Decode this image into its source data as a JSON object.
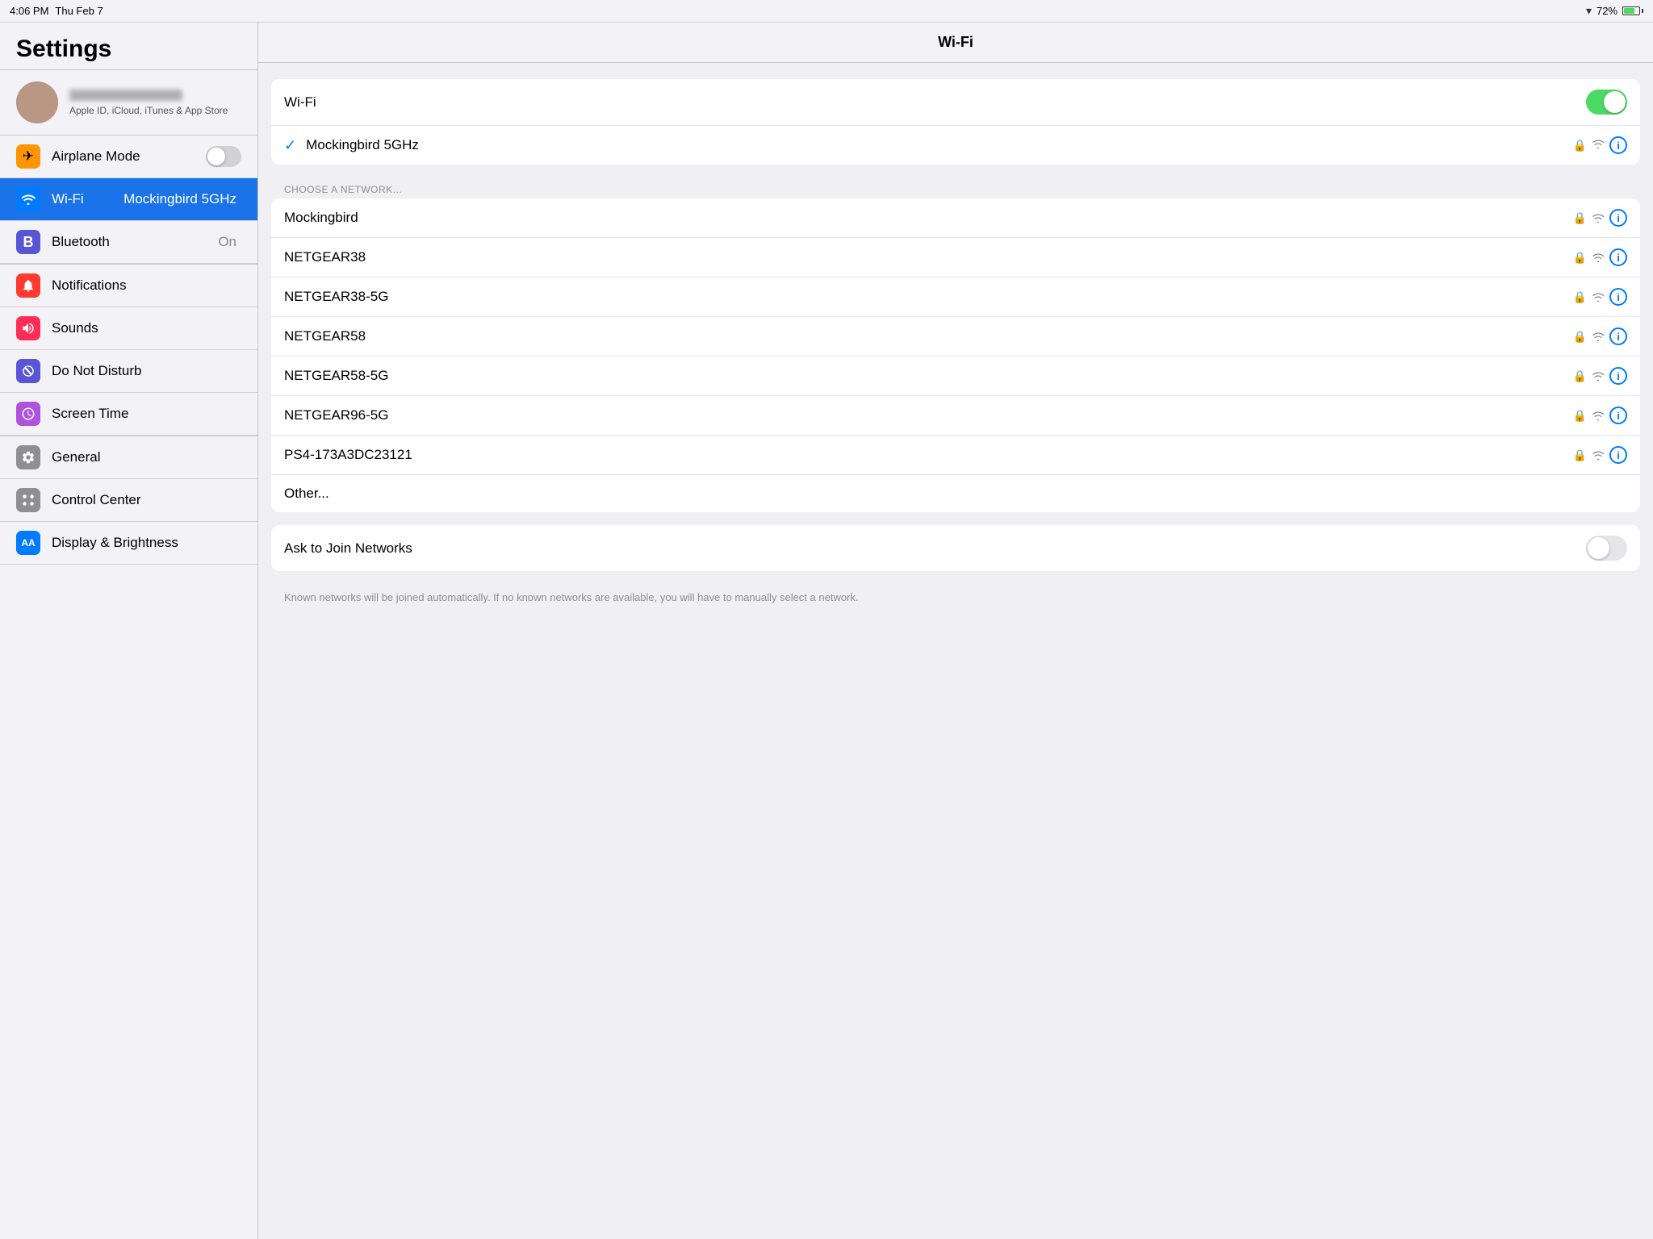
{
  "statusBar": {
    "time": "4:06 PM",
    "date": "Thu Feb 7",
    "battery": "72%"
  },
  "sidebar": {
    "title": "Settings",
    "profile": {
      "subtext": "Apple ID, iCloud, iTunes & App Store"
    },
    "items": [
      {
        "id": "airplane-mode",
        "label": "Airplane Mode",
        "icon": "✈",
        "iconBg": "bg-orange",
        "hasToggle": true,
        "toggleOn": false
      },
      {
        "id": "wifi",
        "label": "Wi-Fi",
        "icon": "📶",
        "iconBg": "bg-blue",
        "value": "Mockingbird 5GHz",
        "active": true
      },
      {
        "id": "bluetooth",
        "label": "Bluetooth",
        "icon": "B",
        "iconBg": "bg-blue2",
        "value": "On"
      },
      {
        "id": "notifications",
        "label": "Notifications",
        "icon": "🔴",
        "iconBg": "bg-red",
        "value": ""
      },
      {
        "id": "sounds",
        "label": "Sounds",
        "icon": "🔊",
        "iconBg": "bg-red2",
        "value": ""
      },
      {
        "id": "do-not-disturb",
        "label": "Do Not Disturb",
        "icon": "🌙",
        "iconBg": "bg-indigo",
        "value": ""
      },
      {
        "id": "screen-time",
        "label": "Screen Time",
        "icon": "⏳",
        "iconBg": "bg-purple2",
        "value": ""
      },
      {
        "id": "general",
        "label": "General",
        "icon": "⚙",
        "iconBg": "bg-gray",
        "value": ""
      },
      {
        "id": "control-center",
        "label": "Control Center",
        "icon": "◉",
        "iconBg": "bg-gray",
        "value": ""
      },
      {
        "id": "display-brightness",
        "label": "Display & Brightness",
        "icon": "AA",
        "iconBg": "bg-blue",
        "value": ""
      }
    ]
  },
  "main": {
    "title": "Wi-Fi",
    "wifiToggleOn": true,
    "connectedNetwork": "Mockingbird 5GHz",
    "sectionHeader": "CHOOSE A NETWORK...",
    "networks": [
      {
        "name": "Mockingbird",
        "locked": true,
        "hasWifi": true,
        "hasInfo": true
      },
      {
        "name": "NETGEAR38",
        "locked": true,
        "hasWifi": true,
        "hasInfo": true
      },
      {
        "name": "NETGEAR38-5G",
        "locked": true,
        "hasWifi": true,
        "hasInfo": true
      },
      {
        "name": "NETGEAR58",
        "locked": true,
        "hasWifi": true,
        "hasInfo": true
      },
      {
        "name": "NETGEAR58-5G",
        "locked": true,
        "hasWifi": true,
        "hasInfo": true
      },
      {
        "name": "NETGEAR96-5G",
        "locked": true,
        "hasWifi": true,
        "hasInfo": true
      },
      {
        "name": "PS4-173A3DC23121",
        "locked": true,
        "hasWifi": true,
        "hasInfo": true
      },
      {
        "name": "Other...",
        "locked": false,
        "hasWifi": false,
        "hasInfo": false
      }
    ],
    "askToJoin": {
      "label": "Ask to Join Networks",
      "toggleOn": false
    },
    "footerText": "Known networks will be joined automatically. If no known networks are available, you will have to manually select a network."
  }
}
